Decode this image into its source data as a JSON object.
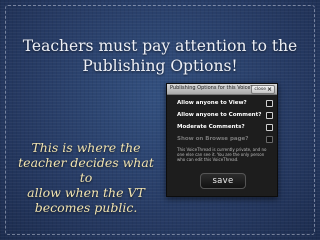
{
  "slide": {
    "title_line1": "Teachers must pay attention to the",
    "title_line2": "Publishing Options!",
    "side_text": [
      "This is where the",
      "teacher decides what to",
      "allow when the VT",
      "becomes public."
    ]
  },
  "dialog": {
    "title": "Publishing Options for this VoiceThread",
    "close_label": "close",
    "close_icon": "close-icon",
    "options": [
      {
        "label": "Allow anyone to View?",
        "checked": false,
        "enabled": true
      },
      {
        "label": "Allow anyone to Comment?",
        "checked": false,
        "enabled": true
      },
      {
        "label": "Moderate Comments?",
        "checked": false,
        "enabled": true
      },
      {
        "label": "Show on Browse page?",
        "checked": false,
        "enabled": false
      }
    ],
    "info_text": "This VoiceThread is currently private, and no one else can see it. You are the only person who can edit this VoiceThread.",
    "save_label": "save"
  },
  "colors": {
    "background": "#2a3f6b",
    "title_text": "#eef0f6",
    "side_text": "#f2e4b0",
    "dialog_bg": "#1d1d1d"
  }
}
